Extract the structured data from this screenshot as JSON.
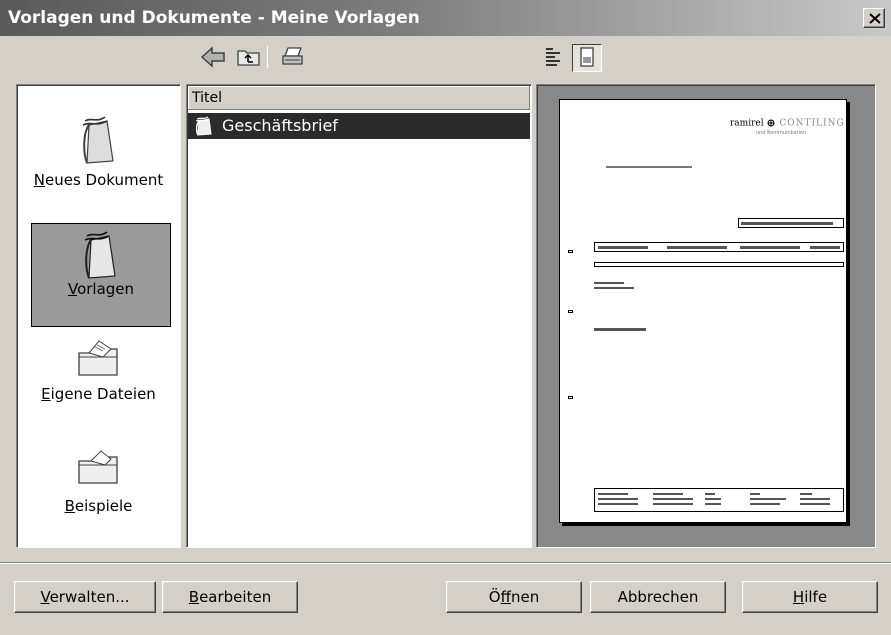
{
  "window": {
    "title": "Vorlagen und Dokumente - Meine Vorlagen"
  },
  "nav": [
    {
      "label": "Neues Dokument",
      "mnemonic": "N",
      "rest": "eues Dokument",
      "icon": "new-document-icon"
    },
    {
      "label": "Vorlagen",
      "mnemonic": "V",
      "rest": "orlagen",
      "icon": "templates-icon",
      "selected": true
    },
    {
      "label": "Eigene Dateien",
      "mnemonic": "E",
      "rest": "igene Dateien",
      "icon": "my-documents-folder-icon"
    },
    {
      "label": "Beispiele",
      "mnemonic": "B",
      "rest": "eispiele",
      "icon": "samples-folder-icon"
    }
  ],
  "list": {
    "column_header": "Titel",
    "items": [
      {
        "title": "Geschäftsbrief",
        "icon": "template-icon",
        "selected": true
      }
    ]
  },
  "preview": {
    "logo_text": "ramirel",
    "logo_suffix": "CONTILING",
    "logo_tagline": "und Kommunikation"
  },
  "buttons": {
    "manage": {
      "mnemonic": "V",
      "rest": "erwalten..."
    },
    "edit": {
      "mnemonic": "B",
      "rest": "earbeiten"
    },
    "open_pre": "Ö",
    "open_mnemonic": "f",
    "open_rest": "fnen",
    "cancel": "Abbrechen",
    "help": {
      "mnemonic": "H",
      "rest": "ilfe"
    }
  }
}
